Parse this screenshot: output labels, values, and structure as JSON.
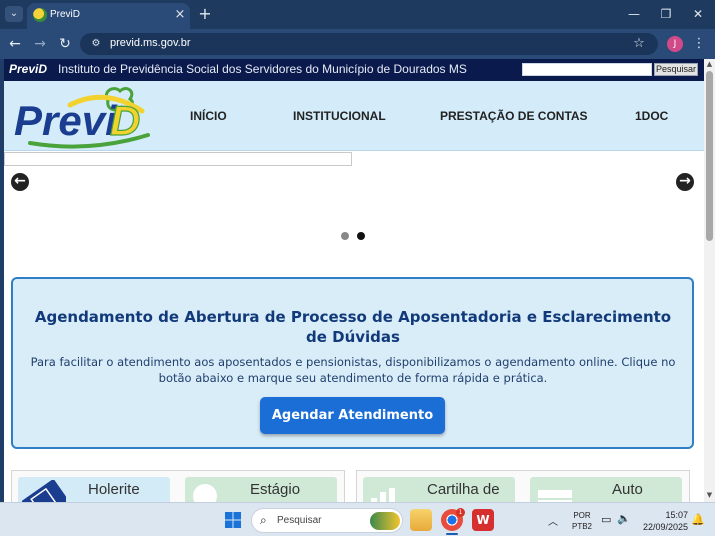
{
  "browser": {
    "tab_title": "PreviD",
    "url": "previd.ms.gov.br",
    "profile_initial": "J"
  },
  "topbar": {
    "brand": "PreviD",
    "institute_name": "Instituto de Previdência Social dos Servidores do Município de Dourados MS",
    "search_button": "Pesquisar",
    "search_value": ""
  },
  "header": {
    "logo_text": "PreviD",
    "nav": [
      "INÍCIO",
      "INSTITUCIONAL",
      "PRESTAÇÃO DE CONTAS",
      "1DOC"
    ]
  },
  "carousel": {
    "prev_icon": "arrow-left-circle-icon",
    "next_icon": "arrow-right-circle-icon",
    "slide_count": 2,
    "active_slide": 2
  },
  "promo": {
    "title": "Agendamento de Abertura de Processo de Aposentadoria e Esclarecimento de Dúvidas",
    "text": "Para facilitar o atendimento aos aposentados e pensionistas, disponibilizamos o agendamento online. Clique no botão abaixo e marque seu atendimento de forma rápida e prática.",
    "button_label": "Agendar Atendimento"
  },
  "cards": [
    {
      "label": "Holerite"
    },
    {
      "label": "Estágio"
    },
    {
      "label": "Cartilha de"
    },
    {
      "label": "Auto"
    }
  ],
  "taskbar": {
    "search_placeholder": "Pesquisar",
    "chrome_badge": "1",
    "lang_line1": "POR",
    "lang_line2": "PTB2",
    "time": "15:07",
    "date": "22/09/2025"
  },
  "colors": {
    "topbar_bg": "#0a1a4d",
    "header_bg": "#d4ecf9",
    "promo_border": "#2f7fc7",
    "promo_title": "#123a7a",
    "button_bg": "#1a6ed6",
    "logo_blue": "#1b3d8f",
    "logo_green": "#4aa23a",
    "logo_yellow": "#f2d22e"
  }
}
